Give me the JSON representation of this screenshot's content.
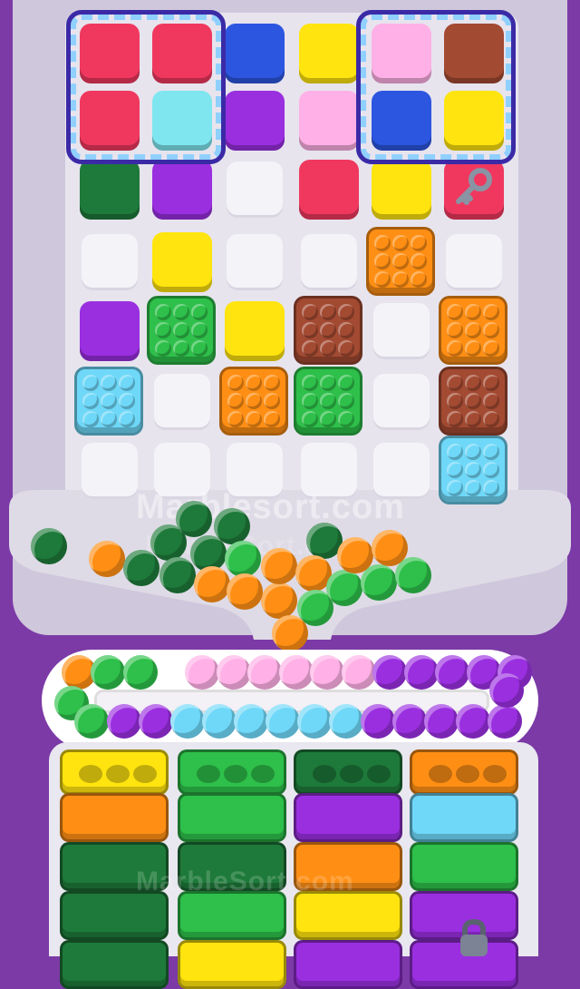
{
  "watermarks": {
    "main": "Marblesort.com",
    "secondary": "MarbleSort.com",
    "bottom": "MarbleSort.com"
  },
  "colors": {
    "red": "#f0385f",
    "cyan": "#7fe6ef",
    "blue": "#2c56e0",
    "yellow": "#ffe40f",
    "pink": "#ffb0e6",
    "brown": "#a34a32",
    "purple": "#9a2fe0",
    "darkgreen": "#1e7a3a",
    "green": "#2ec04a",
    "orange": "#ff8f14",
    "skyblue": "#6fd8f8",
    "light": "#f4f3f8"
  },
  "board": {
    "blocks": [
      {
        "color": "red",
        "type": "plain"
      },
      {
        "color": "red",
        "type": "plain"
      },
      {
        "color": "blue",
        "type": "plain"
      },
      {
        "color": "yellow",
        "type": "plain"
      },
      {
        "color": "pink",
        "type": "plain"
      },
      {
        "color": "brown",
        "type": "plain"
      },
      {
        "color": "red",
        "type": "plain"
      },
      {
        "color": "cyan",
        "type": "plain"
      },
      {
        "color": "purple",
        "type": "plain"
      },
      {
        "color": "pink",
        "type": "plain"
      },
      {
        "color": "blue",
        "type": "plain"
      },
      {
        "color": "yellow",
        "type": "plain"
      },
      {
        "color": "darkgreen",
        "type": "plain"
      },
      {
        "color": "purple",
        "type": "plain"
      },
      {
        "color": "red",
        "type": "plain"
      },
      {
        "color": "yellow",
        "type": "plain"
      },
      {
        "color": "red",
        "type": "key"
      },
      {
        "color": "yellow",
        "type": "plain"
      },
      {
        "color": "orange",
        "type": "studs"
      },
      {
        "color": "purple",
        "type": "plain"
      },
      {
        "color": "green",
        "type": "studs"
      },
      {
        "color": "yellow",
        "type": "plain"
      },
      {
        "color": "brown",
        "type": "studs"
      },
      {
        "color": "orange",
        "type": "studs"
      },
      {
        "color": "skyblue",
        "type": "studs"
      },
      {
        "color": "orange",
        "type": "studs"
      },
      {
        "color": "green",
        "type": "studs"
      },
      {
        "color": "brown",
        "type": "studs"
      },
      {
        "color": "skyblue",
        "type": "studs"
      }
    ],
    "key_icon": "key-icon"
  },
  "funnel_balls": [
    "darkgreen",
    "orange",
    "darkgreen",
    "darkgreen",
    "darkgreen",
    "darkgreen",
    "darkgreen",
    "darkgreen",
    "orange",
    "green",
    "orange",
    "orange",
    "orange",
    "darkgreen",
    "orange",
    "green",
    "green",
    "green",
    "orange",
    "green",
    "orange"
  ],
  "conveyor": {
    "top_row": [
      "orange",
      "green",
      "green",
      "empty",
      "pink",
      "pink",
      "pink",
      "pink",
      "pink",
      "pink",
      "purple",
      "purple",
      "purple",
      "purple",
      "purple"
    ],
    "bottom_row": [
      "green",
      "green",
      "purple",
      "purple",
      "skyblue",
      "skyblue",
      "skyblue",
      "skyblue",
      "skyblue",
      "skyblue",
      "purple",
      "purple",
      "purple",
      "purple",
      "purple"
    ]
  },
  "columns": [
    {
      "slots": [
        "yellow",
        "orange",
        "darkgreen",
        "darkgreen",
        "darkgreen"
      ]
    },
    {
      "slots": [
        "green",
        "green",
        "darkgreen",
        "green",
        "yellow"
      ]
    },
    {
      "slots": [
        "darkgreen",
        "purple",
        "orange",
        "yellow",
        "purple"
      ]
    },
    {
      "slots": [
        "orange",
        "skyblue",
        "green",
        "purple",
        "purple"
      ]
    }
  ],
  "lock_icon": "lock-icon"
}
